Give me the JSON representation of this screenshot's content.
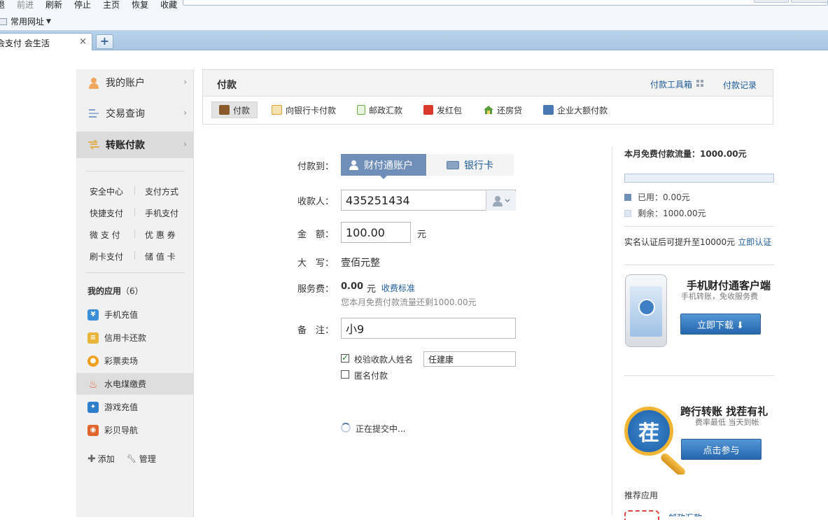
{
  "browser": {
    "menu": [
      "退",
      "前进",
      "刷新",
      "停止",
      "主页",
      "恢复",
      "收藏"
    ],
    "favorites_label": "常用网址",
    "tab_title": "会支付 会生活",
    "tab_close": "×",
    "tab_new": "+"
  },
  "sidebar": {
    "nav": [
      {
        "label": "我的账户",
        "icon": "user-icon"
      },
      {
        "label": "交易查询",
        "icon": "list-icon"
      },
      {
        "label": "转账付款",
        "icon": "transfer-icon",
        "active": true
      }
    ],
    "nav_arrow": "›",
    "quick_links": [
      [
        "安全中心",
        "支付方式"
      ],
      [
        "快捷支付",
        "手机支付"
      ],
      [
        "微 支 付",
        "优 惠 券"
      ],
      [
        "刷卡支付",
        "储 值 卡"
      ]
    ],
    "apps_title": "我的应用",
    "apps_count": "（6）",
    "apps": [
      {
        "label": "手机充值",
        "icon": "mobile-recharge-icon",
        "color": "#3b8fd8"
      },
      {
        "label": "信用卡还款",
        "icon": "credit-card-icon",
        "color": "#e8b43a"
      },
      {
        "label": "彩票卖场",
        "icon": "lottery-icon",
        "color": "#f0a020"
      },
      {
        "label": "水电煤缴费",
        "icon": "utility-flame-icon",
        "color": "#e2572a",
        "active": true
      },
      {
        "label": "游戏充值",
        "icon": "game-pad-icon",
        "color": "#2f7ec9"
      },
      {
        "label": "彩贝导航",
        "icon": "caibei-nav-icon",
        "color": "#e0652c"
      }
    ],
    "add_label": "添加",
    "manage_label": "管理"
  },
  "header": {
    "title": "付款",
    "toolbox": "付款工具箱",
    "records": "付款记录",
    "tabs": [
      {
        "label": "付款",
        "icon": "wallet-icon",
        "color": "#8a5a2b",
        "active": true
      },
      {
        "label": "向银行卡付款",
        "icon": "bank-card-icon",
        "color": "#d6a23a"
      },
      {
        "label": "邮政汇款",
        "icon": "postal-icon",
        "color": "#6aa84f"
      },
      {
        "label": "发红包",
        "icon": "red-envelope-icon",
        "color": "#d93a2b"
      },
      {
        "label": "还房贷",
        "icon": "house-icon",
        "color": "#5a9e3a"
      },
      {
        "label": "企业大额付款",
        "icon": "enterprise-icon",
        "color": "#4a78b5"
      }
    ]
  },
  "form": {
    "pay_to_label": "付款到：",
    "pay_to_tabs": [
      "财付通账户",
      "银行卡"
    ],
    "payee_label": "收款人：",
    "payee_value": "435251434",
    "amount_label": "金　额：",
    "amount_value": "100.00",
    "amount_unit": "元",
    "uppercase_label": "大　写：",
    "uppercase_value": "壹佰元整",
    "fee_label": "服务费：",
    "fee_value": "0.00",
    "fee_unit": "元",
    "fee_link": "收费标准",
    "fee_note": "您本月免费付款流量还剩1000.00元",
    "memo_label": "备　注：",
    "memo_value": "小9",
    "verify_name_label": "校验收款人姓名",
    "verify_name_value": "任建康",
    "anonymous_label": "匿名付款",
    "submitting_text": "正在提交中..."
  },
  "right": {
    "quota_title": "本月免费付款流量：1000.00元",
    "used_label": "已用：0.00元",
    "remaining_label": "剩余：1000.00元",
    "used_color": "#6f8fb8",
    "remaining_color": "#dde6f1",
    "verify_text": "实名认证后可提升至10000元",
    "verify_link": "立即认证",
    "app_promo_title": "手机财付通客户端",
    "app_promo_sub": "手机转账，免收服务费",
    "app_promo_button": "立即下载 ⬇",
    "transfer_promo_title": "跨行转账 找茬有礼",
    "transfer_promo_sub": "费率最低 当天到帐",
    "transfer_promo_button": "点击参与",
    "magnifier_char": "茬",
    "recommended_title": "推荐应用",
    "recommended_partial": "邮政汇款"
  }
}
